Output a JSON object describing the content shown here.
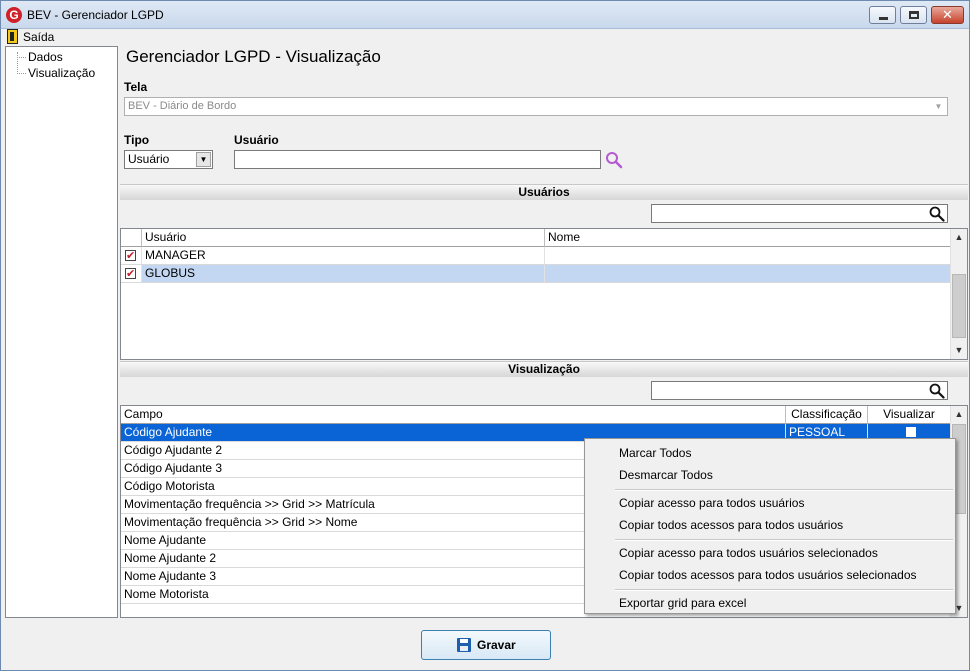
{
  "window": {
    "title": "BEV - Gerenciador LGPD",
    "app_icon": "G"
  },
  "menubar": {
    "exit_label": "Saída"
  },
  "tree": {
    "items": [
      "Dados",
      "Visualização"
    ]
  },
  "page": {
    "heading": "Gerenciador LGPD - Visualização"
  },
  "form": {
    "tela_label": "Tela",
    "tela_value": "BEV - Diário de Bordo",
    "tipo_label": "Tipo",
    "tipo_value": "Usuário",
    "usuario_label": "Usuário",
    "usuario_value": ""
  },
  "usuarios_section": {
    "title": "Usuários",
    "filter_value": "",
    "columns": [
      "Usuário",
      "Nome"
    ],
    "rows": [
      {
        "checked": true,
        "usuario": "MANAGER",
        "nome": ""
      },
      {
        "checked": true,
        "usuario": "GLOBUS",
        "nome": ""
      }
    ]
  },
  "visualizacao_section": {
    "title": "Visualização",
    "filter_value": "",
    "columns": [
      "Campo",
      "Classificação",
      "Visualizar"
    ],
    "rows": [
      {
        "campo": "Código Ajudante",
        "classificacao": "PESSOAL",
        "visualizar": false
      },
      {
        "campo": "Código Ajudante 2",
        "classificacao": "",
        "visualizar": false
      },
      {
        "campo": "Código Ajudante 3",
        "classificacao": "",
        "visualizar": false
      },
      {
        "campo": "Código Motorista",
        "classificacao": "",
        "visualizar": false
      },
      {
        "campo": "Movimentação frequência >> Grid >> Matrícula",
        "classificacao": "",
        "visualizar": false
      },
      {
        "campo": "Movimentação frequência >> Grid >> Nome",
        "classificacao": "",
        "visualizar": false
      },
      {
        "campo": "Nome Ajudante",
        "classificacao": "",
        "visualizar": false
      },
      {
        "campo": "Nome Ajudante 2",
        "classificacao": "",
        "visualizar": false
      },
      {
        "campo": "Nome Ajudante 3",
        "classificacao": "",
        "visualizar": false
      },
      {
        "campo": "Nome Motorista",
        "classificacao": "",
        "visualizar": false
      }
    ]
  },
  "context_menu": {
    "items": [
      "Marcar Todos",
      "Desmarcar Todos",
      "Copiar acesso para todos usuários",
      "Copiar todos acessos para todos usuários",
      "Copiar acesso para todos usuários selecionados",
      "Copiar todos acessos para todos usuários selecionados",
      "Exportar grid para excel"
    ]
  },
  "footer": {
    "save_label": "Gravar",
    "save_icon": "floppy-disk-icon"
  },
  "colors": {
    "selection": "#0a64d6",
    "selection_soft": "#c3d7f3",
    "check_mark": "#c0202a"
  }
}
